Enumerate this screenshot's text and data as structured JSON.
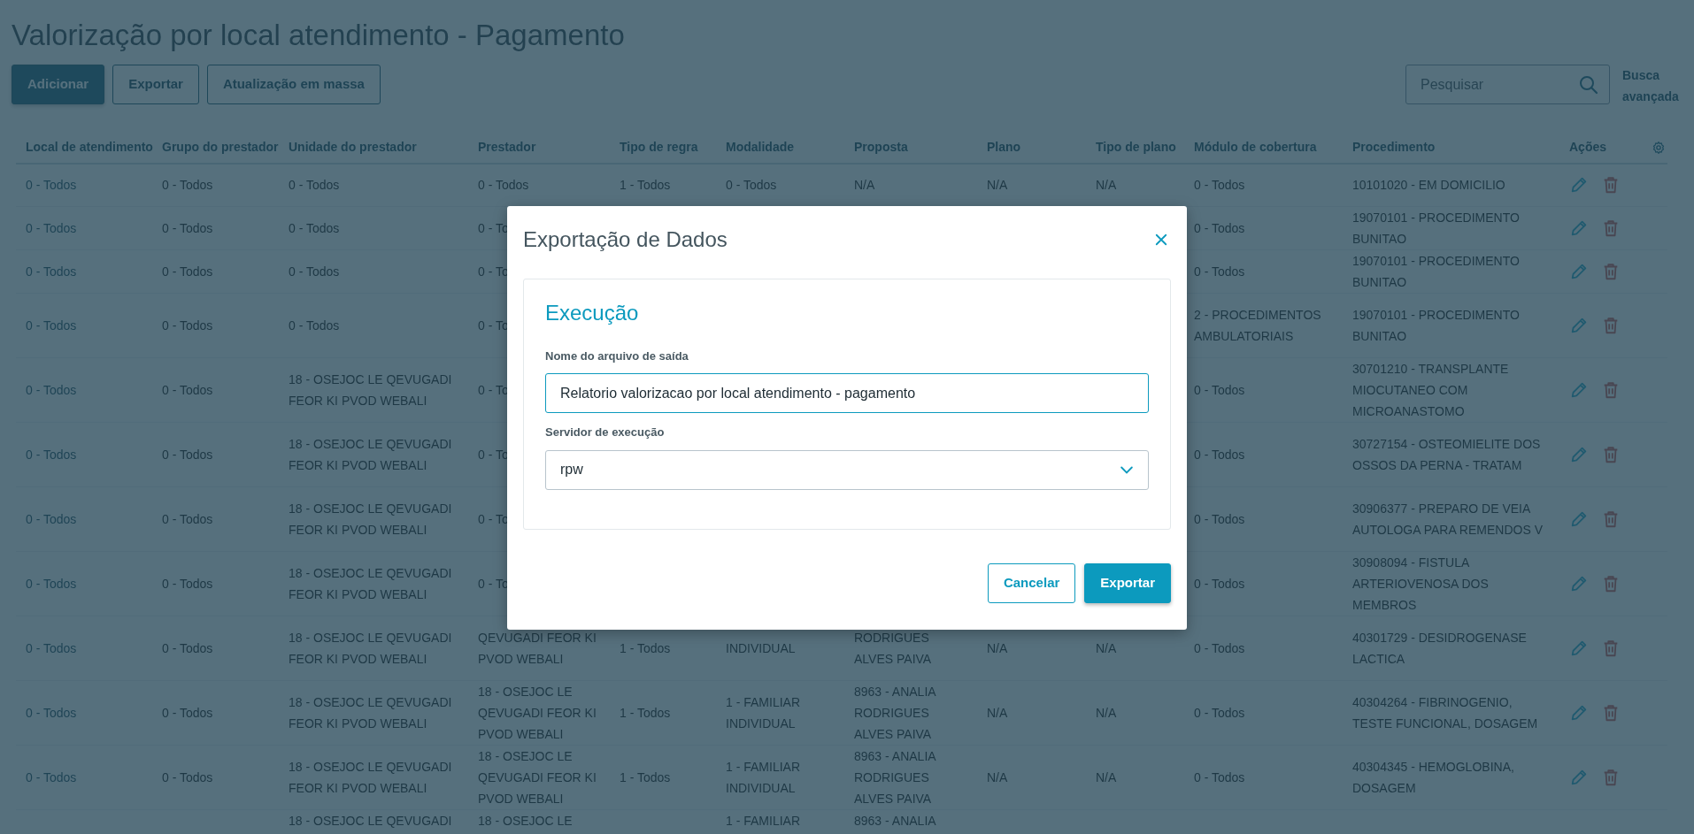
{
  "page": {
    "title": "Valorização por local atendimento - Pagamento"
  },
  "toolbar": {
    "buttons": [
      {
        "label": "Adicionar",
        "kind": "primary"
      },
      {
        "label": "Exportar",
        "kind": "outline"
      },
      {
        "label": "Atualização em massa",
        "kind": "outline"
      }
    ],
    "search": {
      "placeholder": "Pesquisar"
    },
    "advanced_search": "Busca avançada"
  },
  "table": {
    "columns": [
      "Local de atendimento",
      "Grupo do prestador",
      "Unidade do prestador",
      "Prestador",
      "Tipo de regra",
      "Modalidade",
      "Proposta",
      "Plano",
      "Tipo de plano",
      "Módulo de cobertura",
      "Procedimento",
      "Ações"
    ],
    "rows": [
      {
        "cells": [
          "0 - Todos",
          "0 - Todos",
          "0 - Todos",
          "0 - Todos",
          "1 - Todos",
          "0 - Todos",
          "N/A",
          "N/A",
          "N/A",
          "0 - Todos",
          "10101020 - EM DOMICILIO"
        ]
      },
      {
        "cells": [
          "0 - Todos",
          "0 - Todos",
          "0 - Todos",
          "0 - To",
          null,
          null,
          null,
          null,
          null,
          "0 - Todos",
          "19070101 - PROCEDIMENTO BUNITAO"
        ]
      },
      {
        "cells": [
          "0 - Todos",
          "0 - Todos",
          "0 - Todos",
          "0 - To",
          null,
          null,
          null,
          null,
          null,
          "0 - Todos",
          "19070101 - PROCEDIMENTO BUNITAO"
        ]
      },
      {
        "cells": [
          "0 - Todos",
          "0 - Todos",
          "0 - Todos",
          "0 - To",
          null,
          null,
          null,
          null,
          null,
          "2 - PROCEDIMENTOS AMBULATORIAIS",
          "19070101 - PROCEDIMENTO BUNITAO"
        ]
      },
      {
        "cells": [
          "0 - Todos",
          "0 - Todos",
          "18 - OSEJOC LE QEVUGADI FEOR KI PVOD WEBALI",
          "0 - To",
          null,
          null,
          null,
          null,
          null,
          "0 - Todos",
          "30701210 - TRANSPLANTE MIOCUTANEO COM MICROANASTOMO"
        ]
      },
      {
        "cells": [
          "0 - Todos",
          "0 - Todos",
          "18 - OSEJOC LE QEVUGADI FEOR KI PVOD WEBALI",
          "0 - To",
          null,
          null,
          null,
          null,
          null,
          "0 - Todos",
          "30727154 - OSTEOMIELITE DOS OSSOS DA PERNA - TRATAM"
        ]
      },
      {
        "cells": [
          "0 - Todos",
          "0 - Todos",
          "18 - OSEJOC LE QEVUGADI FEOR KI PVOD WEBALI",
          "0 - To",
          null,
          null,
          null,
          null,
          null,
          "0 - Todos",
          "30906377 - PREPARO DE VEIA AUTOLOGA PARA REMENDOS V"
        ]
      },
      {
        "cells": [
          "0 - Todos",
          "0 - Todos",
          "18 - OSEJOC LE QEVUGADI FEOR KI PVOD WEBALI",
          "0 - To",
          null,
          null,
          null,
          null,
          null,
          "0 - Todos",
          "30908094 - FISTULA ARTERIOVENOSA DOS MEMBROS"
        ]
      },
      {
        "cells": [
          "0 - Todos",
          "0 - Todos",
          "18 - OSEJOC LE QEVUGADI FEOR KI PVOD WEBALI",
          "QEVUGADI FEOR KI PVOD WEBALI",
          "1 - Todos",
          "INDIVIDUAL",
          "RODRIGUES ALVES PAIVA",
          "N/A",
          "N/A",
          "0 - Todos",
          "40301729 - DESIDROGENASE LACTICA"
        ]
      },
      {
        "cells": [
          "0 - Todos",
          "0 - Todos",
          "18 - OSEJOC LE QEVUGADI FEOR KI PVOD WEBALI",
          "18 - OSEJOC LE QEVUGADI FEOR KI PVOD WEBALI",
          "1 - Todos",
          "1 - FAMILIAR INDIVIDUAL",
          "8963 - ANALIA RODRIGUES ALVES PAIVA",
          "N/A",
          "N/A",
          "0 - Todos",
          "40304264 - FIBRINOGENIO, TESTE FUNCIONAL, DOSAGEM"
        ]
      },
      {
        "cells": [
          "0 - Todos",
          "0 - Todos",
          "18 - OSEJOC LE QEVUGADI FEOR KI PVOD WEBALI",
          "18 - OSEJOC LE QEVUGADI FEOR KI PVOD WEBALI",
          "1 - Todos",
          "1 - FAMILIAR INDIVIDUAL",
          "8963 - ANALIA RODRIGUES ALVES PAIVA",
          "N/A",
          "N/A",
          "0 - Todos",
          "40304345 - HEMOGLOBINA, DOSAGEM"
        ]
      },
      {
        "kind": "partial",
        "cells": [
          null,
          null,
          "18 - OSEJOC LE QEVUGADI",
          "18 - OSEJOC LE",
          null,
          "1 - FAMILIAR",
          "8963 - ANALIA",
          null,
          null,
          null,
          null
        ]
      }
    ]
  },
  "modal": {
    "title": "Exportação de Dados",
    "section": "Execução",
    "fields": [
      {
        "kind": "text",
        "label": "Nome do arquivo de saída",
        "value": "Relatorio valorizacao por local atendimento - pagamento",
        "focused": true
      },
      {
        "kind": "select",
        "label": "Servidor de execução",
        "value": "rpw",
        "focused": false
      }
    ],
    "buttons": [
      {
        "label": "Cancelar",
        "kind": "outline"
      },
      {
        "label": "Exportar",
        "kind": "primary"
      }
    ]
  }
}
